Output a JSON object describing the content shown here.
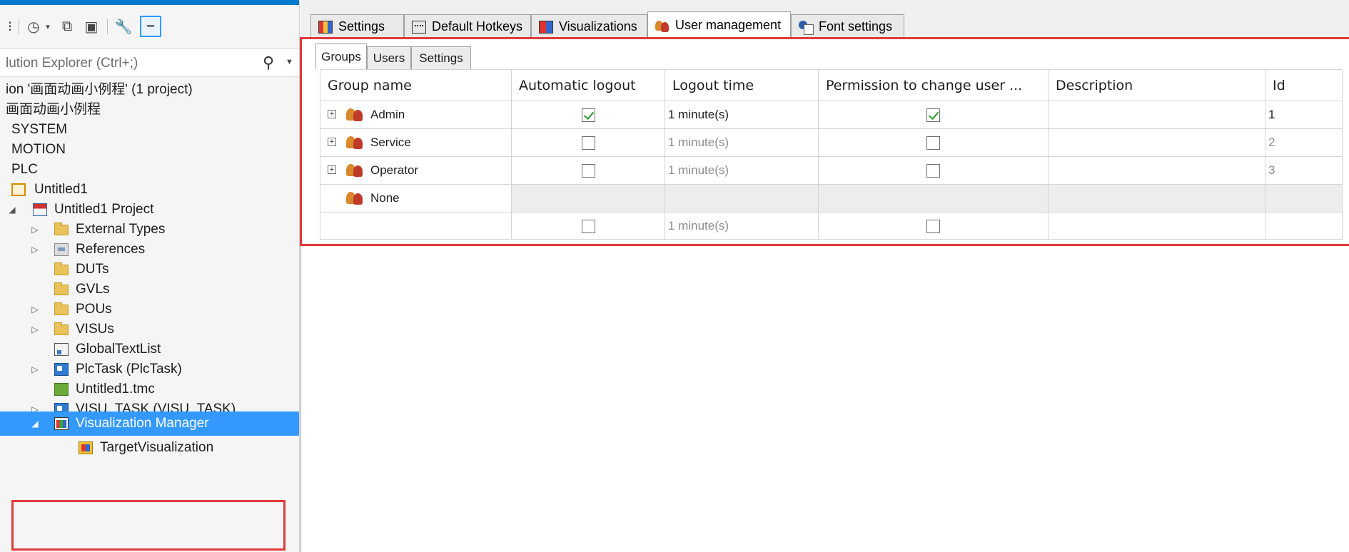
{
  "search": {
    "text": "lution Explorer (Ctrl+;)"
  },
  "tree": {
    "solution": "ion '画面动画小例程' (1 project)",
    "project_root": "画面动画小例程",
    "system": "SYSTEM",
    "motion": "MOTION",
    "plc": "PLC",
    "untitled1": "Untitled1",
    "untitled1_project": "Untitled1 Project",
    "external_types": "External Types",
    "references": "References",
    "duts": "DUTs",
    "gvls": "GVLs",
    "pous": "POUs",
    "visus": "VISUs",
    "global_text_list": "GlobalTextList",
    "plc_task": "PlcTask (PlcTask)",
    "untitled1_tmc": "Untitled1.tmc",
    "visu_task": "VISU_TASK (VISU_TASK)",
    "visualization_manager": "Visualization Manager",
    "target_visualization": "TargetVisualization"
  },
  "tabs": {
    "settings": "Settings",
    "default_hotkeys": "Default Hotkeys",
    "visualizations": "Visualizations",
    "user_management": "User management",
    "font_settings": "Font settings",
    "active": "User management"
  },
  "subtabs": {
    "groups": "Groups",
    "users": "Users",
    "settings": "Settings",
    "active": "Groups"
  },
  "grid": {
    "headers": {
      "group_name": "Group name",
      "automatic_logout": "Automatic logout",
      "logout_time": "Logout time",
      "permission": "Permission to change user ...",
      "description": "Description",
      "id": "Id"
    },
    "rows": [
      {
        "name": "Admin",
        "expandable": true,
        "auto_logout": true,
        "logout_time": "1 minute(s)",
        "permission": true,
        "description": "",
        "id": "1"
      },
      {
        "name": "Service",
        "expandable": true,
        "auto_logout": false,
        "logout_time": "1 minute(s)",
        "permission": false,
        "description": "",
        "id": "2"
      },
      {
        "name": "Operator",
        "expandable": true,
        "auto_logout": false,
        "logout_time": "1 minute(s)",
        "permission": false,
        "description": "",
        "id": "3"
      },
      {
        "name": "None",
        "expandable": false,
        "auto_logout": null,
        "logout_time": "",
        "permission": null,
        "description": "",
        "id": ""
      },
      {
        "name": "",
        "expandable": false,
        "auto_logout": false,
        "logout_time": "1 minute(s)",
        "permission": false,
        "description": "",
        "id": ""
      }
    ]
  },
  "colors": {
    "accent": "#007acc",
    "selection": "#3399ff",
    "highlight_box": "#e03a3a",
    "check": "#2a9a2a"
  },
  "icons": {
    "toolbar": [
      "history-icon",
      "copy-icon",
      "properties-icon",
      "wrench-icon",
      "pin-icon"
    ],
    "tabs": [
      "settings-icon",
      "keyboard-icon",
      "visualization-icon",
      "users-icon",
      "font-icon"
    ]
  }
}
